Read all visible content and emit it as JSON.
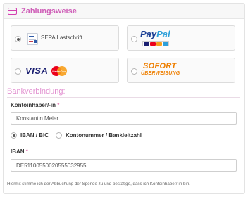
{
  "header": {
    "title": "Zahlungsweise",
    "icon": "credit-card-icon"
  },
  "payment_methods": [
    {
      "id": "sepa",
      "label": "SEPA Lastschrift",
      "selected": true
    },
    {
      "id": "paypal",
      "logo_text_1": "Pay",
      "logo_text_2": "Pal",
      "selected": false
    },
    {
      "id": "visa-mastercard",
      "logo_text": "VISA",
      "mastercard_text": "MasterCard",
      "selected": false
    },
    {
      "id": "sofort",
      "logo_text_1": "SOFORT",
      "logo_text_2": "ÜBERWEISUNG",
      "selected": false
    }
  ],
  "bank": {
    "section_title": "Bankverbindung:",
    "holder_label": "Kontoinhaber/-in",
    "required_mark": "*",
    "holder_value": "Konstantin Meier",
    "option_iban_label": "IBAN / BIC",
    "option_konto_label": "Kontonummer / Bankleitzahl",
    "selected_option": "iban",
    "iban_label": "IBAN",
    "iban_value": "DE51100550020555032955"
  },
  "disclaimer": "Hiermit stimme ich der Abbuchung der Spende zu und bestätige, dass ich Kontoinhaber/-in bin.",
  "colors": {
    "accent": "#cf5fb8",
    "required": "#d2358c",
    "paypal_dark": "#1c3f94",
    "paypal_light": "#2c9fd9",
    "sofort": "#ee7f00",
    "visa": "#1a1f71"
  }
}
